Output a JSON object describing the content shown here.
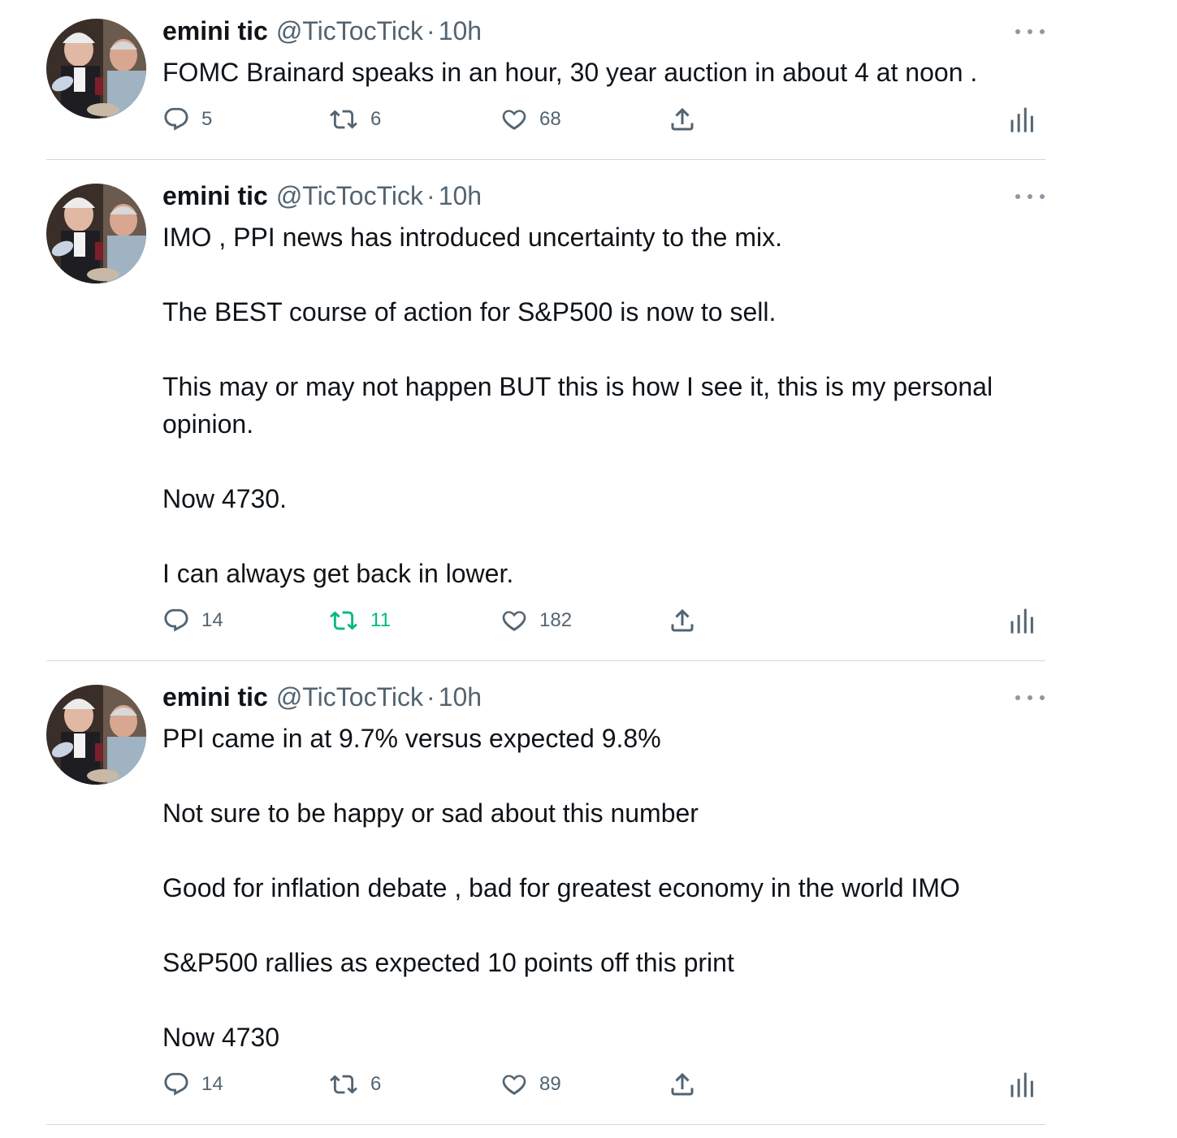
{
  "tweets": [
    {
      "author_name": "emini tic",
      "author_handle": "@TicTocTick",
      "separator": "·",
      "time": "10h",
      "avatar_icon": "avatar-photo",
      "paragraphs": [
        "FOMC Brainard speaks in an hour, 30 year auction in about 4 at noon ."
      ],
      "replies": "5",
      "retweets": "6",
      "likes": "68",
      "retweeted": false
    },
    {
      "author_name": "emini tic",
      "author_handle": "@TicTocTick",
      "separator": "·",
      "time": "10h",
      "avatar_icon": "avatar-photo",
      "paragraphs": [
        "IMO , PPI news has introduced uncertainty to the mix.",
        "The BEST course of action for S&P500 is now to sell.",
        "This may or may not happen BUT this is how I see it, this is my personal opinion.",
        "Now 4730.",
        "I can always get back in lower."
      ],
      "replies": "14",
      "retweets": "11",
      "likes": "182",
      "retweeted": true
    },
    {
      "author_name": "emini tic",
      "author_handle": "@TicTocTick",
      "separator": "·",
      "time": "10h",
      "avatar_icon": "avatar-photo",
      "paragraphs": [
        "PPI came in at 9.7% versus expected 9.8%",
        "Not sure to be happy or sad about this number",
        "Good for inflation debate , bad for greatest economy in the world IMO",
        "S&P500 rallies as expected 10 points off this print",
        "Now 4730"
      ],
      "replies": "14",
      "retweets": "6",
      "likes": "89",
      "retweeted": false
    }
  ],
  "colors": {
    "text": "#0f1419",
    "secondary": "#536471",
    "retweet_active": "#00ba7c",
    "divider": "#cfd9de"
  },
  "icons": [
    "reply-icon",
    "retweet-icon",
    "like-icon",
    "share-icon",
    "analytics-icon",
    "more-icon"
  ]
}
